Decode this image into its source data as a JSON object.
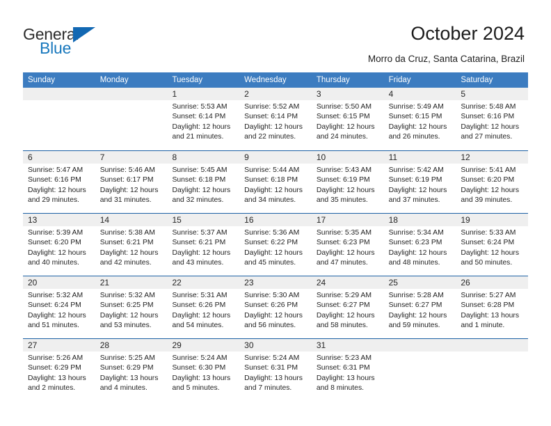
{
  "brand": {
    "name_part1": "General",
    "name_part2": "Blue",
    "triangle_icon": "triangle-icon",
    "color_dark": "#2b2b2b",
    "color_blue": "#1878bd"
  },
  "header": {
    "title": "October 2024",
    "subtitle": "Morro da Cruz, Santa Catarina, Brazil"
  },
  "calendar": {
    "header_bg": "#3c7cc0",
    "header_text_color": "#ffffff",
    "row_divider_color": "#1a5fa4",
    "daynum_band_color": "#efefef",
    "weekdays": [
      "Sunday",
      "Monday",
      "Tuesday",
      "Wednesday",
      "Thursday",
      "Friday",
      "Saturday"
    ],
    "weeks": [
      [
        {
          "day": ""
        },
        {
          "day": ""
        },
        {
          "day": "1",
          "sunrise": "Sunrise: 5:53 AM",
          "sunset": "Sunset: 6:14 PM",
          "daylight": "Daylight: 12 hours and 21 minutes."
        },
        {
          "day": "2",
          "sunrise": "Sunrise: 5:52 AM",
          "sunset": "Sunset: 6:14 PM",
          "daylight": "Daylight: 12 hours and 22 minutes."
        },
        {
          "day": "3",
          "sunrise": "Sunrise: 5:50 AM",
          "sunset": "Sunset: 6:15 PM",
          "daylight": "Daylight: 12 hours and 24 minutes."
        },
        {
          "day": "4",
          "sunrise": "Sunrise: 5:49 AM",
          "sunset": "Sunset: 6:15 PM",
          "daylight": "Daylight: 12 hours and 26 minutes."
        },
        {
          "day": "5",
          "sunrise": "Sunrise: 5:48 AM",
          "sunset": "Sunset: 6:16 PM",
          "daylight": "Daylight: 12 hours and 27 minutes."
        }
      ],
      [
        {
          "day": "6",
          "sunrise": "Sunrise: 5:47 AM",
          "sunset": "Sunset: 6:16 PM",
          "daylight": "Daylight: 12 hours and 29 minutes."
        },
        {
          "day": "7",
          "sunrise": "Sunrise: 5:46 AM",
          "sunset": "Sunset: 6:17 PM",
          "daylight": "Daylight: 12 hours and 31 minutes."
        },
        {
          "day": "8",
          "sunrise": "Sunrise: 5:45 AM",
          "sunset": "Sunset: 6:18 PM",
          "daylight": "Daylight: 12 hours and 32 minutes."
        },
        {
          "day": "9",
          "sunrise": "Sunrise: 5:44 AM",
          "sunset": "Sunset: 6:18 PM",
          "daylight": "Daylight: 12 hours and 34 minutes."
        },
        {
          "day": "10",
          "sunrise": "Sunrise: 5:43 AM",
          "sunset": "Sunset: 6:19 PM",
          "daylight": "Daylight: 12 hours and 35 minutes."
        },
        {
          "day": "11",
          "sunrise": "Sunrise: 5:42 AM",
          "sunset": "Sunset: 6:19 PM",
          "daylight": "Daylight: 12 hours and 37 minutes."
        },
        {
          "day": "12",
          "sunrise": "Sunrise: 5:41 AM",
          "sunset": "Sunset: 6:20 PM",
          "daylight": "Daylight: 12 hours and 39 minutes."
        }
      ],
      [
        {
          "day": "13",
          "sunrise": "Sunrise: 5:39 AM",
          "sunset": "Sunset: 6:20 PM",
          "daylight": "Daylight: 12 hours and 40 minutes."
        },
        {
          "day": "14",
          "sunrise": "Sunrise: 5:38 AM",
          "sunset": "Sunset: 6:21 PM",
          "daylight": "Daylight: 12 hours and 42 minutes."
        },
        {
          "day": "15",
          "sunrise": "Sunrise: 5:37 AM",
          "sunset": "Sunset: 6:21 PM",
          "daylight": "Daylight: 12 hours and 43 minutes."
        },
        {
          "day": "16",
          "sunrise": "Sunrise: 5:36 AM",
          "sunset": "Sunset: 6:22 PM",
          "daylight": "Daylight: 12 hours and 45 minutes."
        },
        {
          "day": "17",
          "sunrise": "Sunrise: 5:35 AM",
          "sunset": "Sunset: 6:23 PM",
          "daylight": "Daylight: 12 hours and 47 minutes."
        },
        {
          "day": "18",
          "sunrise": "Sunrise: 5:34 AM",
          "sunset": "Sunset: 6:23 PM",
          "daylight": "Daylight: 12 hours and 48 minutes."
        },
        {
          "day": "19",
          "sunrise": "Sunrise: 5:33 AM",
          "sunset": "Sunset: 6:24 PM",
          "daylight": "Daylight: 12 hours and 50 minutes."
        }
      ],
      [
        {
          "day": "20",
          "sunrise": "Sunrise: 5:32 AM",
          "sunset": "Sunset: 6:24 PM",
          "daylight": "Daylight: 12 hours and 51 minutes."
        },
        {
          "day": "21",
          "sunrise": "Sunrise: 5:32 AM",
          "sunset": "Sunset: 6:25 PM",
          "daylight": "Daylight: 12 hours and 53 minutes."
        },
        {
          "day": "22",
          "sunrise": "Sunrise: 5:31 AM",
          "sunset": "Sunset: 6:26 PM",
          "daylight": "Daylight: 12 hours and 54 minutes."
        },
        {
          "day": "23",
          "sunrise": "Sunrise: 5:30 AM",
          "sunset": "Sunset: 6:26 PM",
          "daylight": "Daylight: 12 hours and 56 minutes."
        },
        {
          "day": "24",
          "sunrise": "Sunrise: 5:29 AM",
          "sunset": "Sunset: 6:27 PM",
          "daylight": "Daylight: 12 hours and 58 minutes."
        },
        {
          "day": "25",
          "sunrise": "Sunrise: 5:28 AM",
          "sunset": "Sunset: 6:27 PM",
          "daylight": "Daylight: 12 hours and 59 minutes."
        },
        {
          "day": "26",
          "sunrise": "Sunrise: 5:27 AM",
          "sunset": "Sunset: 6:28 PM",
          "daylight": "Daylight: 13 hours and 1 minute."
        }
      ],
      [
        {
          "day": "27",
          "sunrise": "Sunrise: 5:26 AM",
          "sunset": "Sunset: 6:29 PM",
          "daylight": "Daylight: 13 hours and 2 minutes."
        },
        {
          "day": "28",
          "sunrise": "Sunrise: 5:25 AM",
          "sunset": "Sunset: 6:29 PM",
          "daylight": "Daylight: 13 hours and 4 minutes."
        },
        {
          "day": "29",
          "sunrise": "Sunrise: 5:24 AM",
          "sunset": "Sunset: 6:30 PM",
          "daylight": "Daylight: 13 hours and 5 minutes."
        },
        {
          "day": "30",
          "sunrise": "Sunrise: 5:24 AM",
          "sunset": "Sunset: 6:31 PM",
          "daylight": "Daylight: 13 hours and 7 minutes."
        },
        {
          "day": "31",
          "sunrise": "Sunrise: 5:23 AM",
          "sunset": "Sunset: 6:31 PM",
          "daylight": "Daylight: 13 hours and 8 minutes."
        },
        {
          "day": ""
        },
        {
          "day": ""
        }
      ]
    ]
  }
}
